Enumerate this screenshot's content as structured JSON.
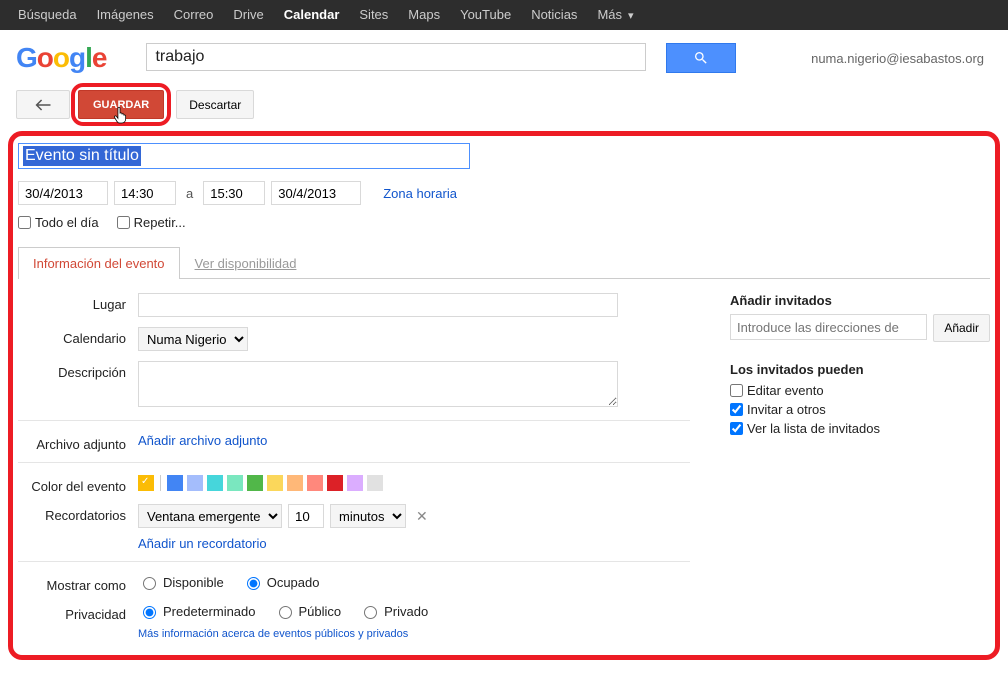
{
  "topnav": {
    "items": [
      "Búsqueda",
      "Imágenes",
      "Correo",
      "Drive",
      "Calendar",
      "Sites",
      "Maps",
      "YouTube",
      "Noticias"
    ],
    "more": "Más",
    "active_index": 4
  },
  "header": {
    "logo_letters": [
      "G",
      "o",
      "o",
      "g",
      "l",
      "e"
    ],
    "search_value": "trabajo",
    "user_email": "numa.nigerio@iesabastos.org"
  },
  "toolbar": {
    "save_label": "GUARDAR",
    "discard_label": "Descartar"
  },
  "event": {
    "title_placeholder": "Evento sin título",
    "date_start": "30/4/2013",
    "time_start": "14:30",
    "to_label": "a",
    "time_end": "15:30",
    "date_end": "30/4/2013",
    "timezone_link": "Zona horaria",
    "all_day_label": "Todo el día",
    "repeat_label": "Repetir..."
  },
  "tabs": {
    "info": "Información del evento",
    "availability": "Ver disponibilidad"
  },
  "form": {
    "location_label": "Lugar",
    "calendar_label": "Calendario",
    "calendar_value": "Numa Nigerio",
    "description_label": "Descripción",
    "attachment_label": "Archivo adjunto",
    "attachment_link": "Añadir archivo adjunto",
    "color_label": "Color del evento",
    "colors": [
      "#fbbc05",
      "#4285f4",
      "#a4bdfc",
      "#46d6db",
      "#7ae7bf",
      "#51b749",
      "#fbd75b",
      "#ffb878",
      "#ff887c",
      "#dc2127",
      "#dbadff",
      "#e1e1e1"
    ],
    "reminders_label": "Recordatorios",
    "reminder_type": "Ventana emergente",
    "reminder_value": "10",
    "reminder_unit": "minutos",
    "add_reminder_link": "Añadir un recordatorio",
    "show_as_label": "Mostrar como",
    "show_as_available": "Disponible",
    "show_as_busy": "Ocupado",
    "privacy_label": "Privacidad",
    "privacy_default": "Predeterminado",
    "privacy_public": "Público",
    "privacy_private": "Privado",
    "privacy_info_link": "Más información acerca de eventos públicos y privados"
  },
  "guests": {
    "heading": "Añadir invitados",
    "placeholder": "Introduce las direcciones de",
    "add_button": "Añadir",
    "perms_heading": "Los invitados pueden",
    "perm_edit": "Editar evento",
    "perm_invite": "Invitar a otros",
    "perm_seelist": "Ver la lista de invitados"
  }
}
